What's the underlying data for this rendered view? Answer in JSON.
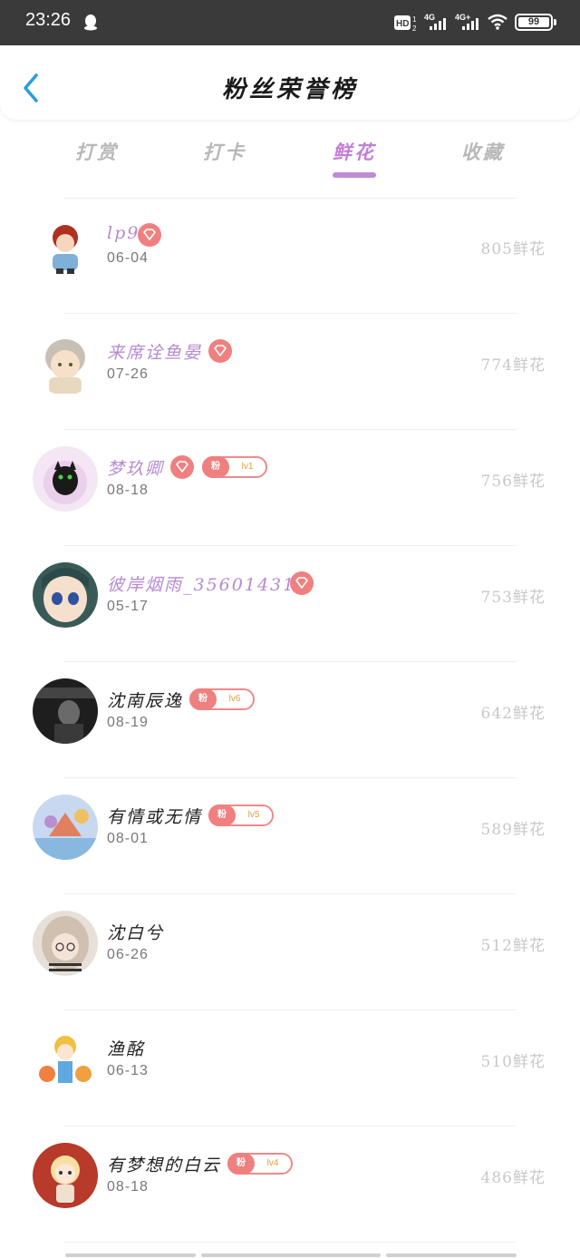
{
  "status": {
    "time": "23:26",
    "network1": "4G",
    "network2": "4G+",
    "battery": "99"
  },
  "header": {
    "title": "粉丝荣誉榜"
  },
  "tabs": [
    {
      "label": "打赏",
      "active": false
    },
    {
      "label": "打卡",
      "active": false
    },
    {
      "label": "鲜花",
      "active": true
    },
    {
      "label": "收藏",
      "active": false
    }
  ],
  "fans": [
    {
      "name": "lp9",
      "date": "06-04",
      "amount": "805鲜花",
      "vip": true,
      "fan_level": null,
      "name_color": "purple"
    },
    {
      "name": "来席诠鱼晏",
      "date": "07-26",
      "amount": "774鲜花",
      "vip": true,
      "fan_level": null,
      "name_color": "purple"
    },
    {
      "name": "梦玖卿",
      "date": "08-18",
      "amount": "756鲜花",
      "vip": true,
      "fan_level": "lv1",
      "name_color": "purple"
    },
    {
      "name": "彼岸烟雨_356014311",
      "date": "05-17",
      "amount": "753鲜花",
      "vip": true,
      "fan_level": null,
      "name_color": "purple"
    },
    {
      "name": "沈南辰逸",
      "date": "08-19",
      "amount": "642鲜花",
      "vip": false,
      "fan_level": "lv6",
      "name_color": "dark"
    },
    {
      "name": "有情或无情",
      "date": "08-01",
      "amount": "589鲜花",
      "vip": false,
      "fan_level": "lv5",
      "name_color": "dark"
    },
    {
      "name": "沈白兮",
      "date": "06-26",
      "amount": "512鲜花",
      "vip": false,
      "fan_level": null,
      "name_color": "dark"
    },
    {
      "name": "渔酩",
      "date": "06-13",
      "amount": "510鲜花",
      "vip": false,
      "fan_level": null,
      "name_color": "dark"
    },
    {
      "name": "有梦想的白云",
      "date": "08-18",
      "amount": "486鲜花",
      "vip": false,
      "fan_level": "lv4",
      "name_color": "dark"
    }
  ],
  "badge": {
    "fan_prefix": "粉"
  },
  "colors": {
    "accent": "#c27ed6",
    "vip_badge": "#f08080",
    "amount": "#c8c8c8"
  }
}
